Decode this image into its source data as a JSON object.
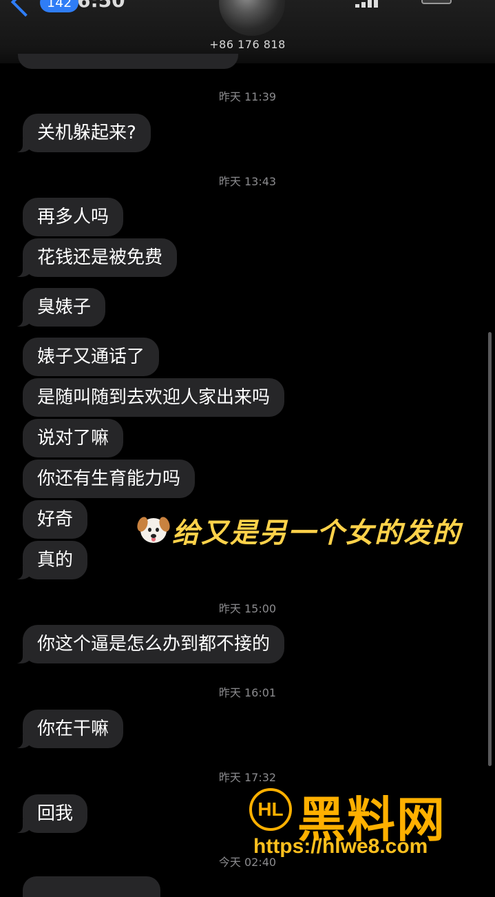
{
  "header": {
    "badge_count": "142",
    "time_fragment": "6:50",
    "contact_number": "+86 176 818"
  },
  "messages": [
    {
      "stamp": "昨天 11:39"
    },
    {
      "text": "关机躲起来?"
    },
    {
      "stamp": "昨天 13:43"
    },
    {
      "text": "再多人吗"
    },
    {
      "text": "花钱还是被免费"
    },
    {
      "text": "臭婊子"
    },
    {
      "text": "婊子又通话了"
    },
    {
      "text": "是随叫随到去欢迎人家出来吗"
    },
    {
      "text": "说对了嘛"
    },
    {
      "text": "你还有生育能力吗"
    },
    {
      "text": "好奇"
    },
    {
      "text": "真的"
    },
    {
      "stamp": "昨天 15:00"
    },
    {
      "text": "你这个逼是怎么办到都不接的"
    },
    {
      "stamp": "昨天 16:01"
    },
    {
      "text": "你在干嘛"
    },
    {
      "stamp": "昨天 17:32"
    },
    {
      "text": "回我"
    },
    {
      "stamp": "今天 02:40"
    }
  ],
  "overlay": {
    "caption": "给又是另一个女的发的",
    "emoji": "dog-face-icon"
  },
  "watermark": {
    "logo": "HL",
    "name": "黑料网",
    "url": "https://hlwe8.com"
  },
  "colors": {
    "bubble": "#262628",
    "accent": "#2f7df6",
    "caption": "#ffd24a",
    "watermark": "#ffb000"
  }
}
